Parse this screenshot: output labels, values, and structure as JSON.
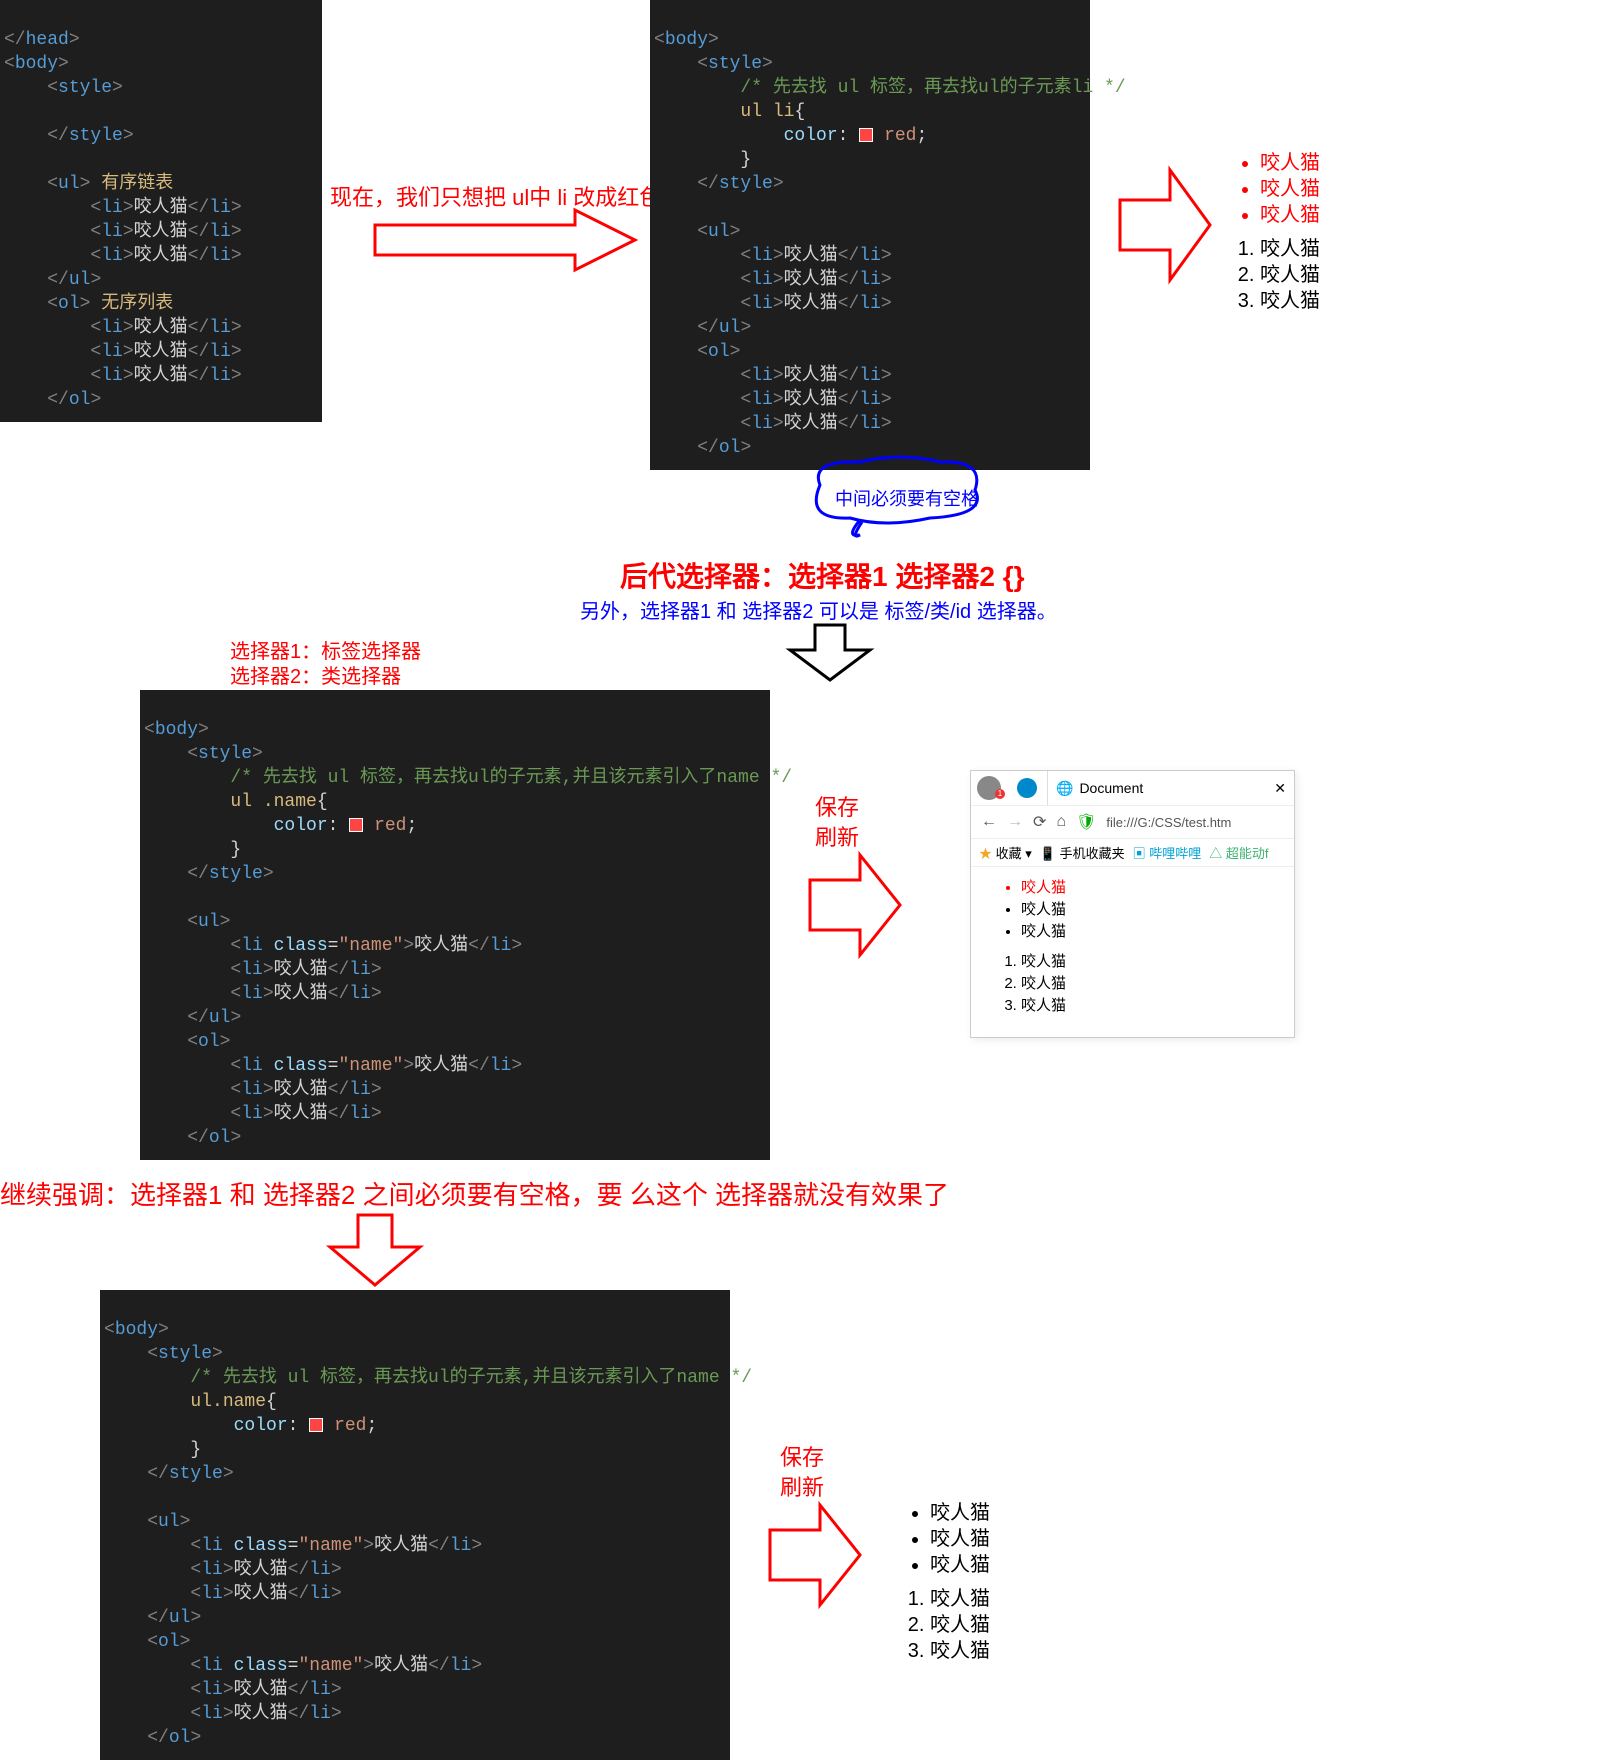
{
  "code1": {
    "open_head_close": "</head>",
    "body": "body",
    "style": "style",
    "ul": "ul",
    "ol": "ol",
    "li": "li",
    "txt": "咬人猫",
    "note_ul": " 有序链表",
    "note_ol": " 无序列表"
  },
  "anno1": "现在，我们只想把 ul中 li 改成红色。",
  "code2": {
    "comment": "/* 先去找 ul 标签，再去找ul的子元素li */",
    "selector": "ul li",
    "prop": "color",
    "val": "red"
  },
  "res1": {
    "items": [
      "咬人猫",
      "咬人猫",
      "咬人猫"
    ]
  },
  "bubble": "中间必须要有空格",
  "title": "后代选择器：选择器1  选择器2 {}",
  "sub": "另外，选择器1 和 选择器2 可以是 标签/类/id 选择器。",
  "sel1": "选择器1：标签选择器",
  "sel2": "选择器2：类选择器",
  "code3": {
    "comment": "/* 先去找 ul 标签，再去找ul的子元素,并且该元素引入了name */",
    "selector": "ul .name",
    "attr": "class",
    "aval": "name"
  },
  "save_refresh": {
    "a": "保存",
    "b": "刷新"
  },
  "browser": {
    "tab_title": "Document",
    "url": "file:///G:/CSS/test.htm",
    "bm_fav": "收藏",
    "bm_mobile": "手机收藏夹",
    "bm_bili": "哔哩哔哩",
    "bm_cn": "超能动f",
    "items": [
      "咬人猫",
      "咬人猫",
      "咬人猫"
    ],
    "olitems": [
      "咬人猫",
      "咬人猫",
      "咬人猫"
    ]
  },
  "emph": "继续强调：选择器1 和 选择器2 之间必须要有空格，要  么这个 选择器就没有效果了",
  "code4": {
    "comment": "/* 先去找 ul 标签，再去找ul的子元素,并且该元素引入了name */",
    "selector": "ul.name"
  },
  "res3": {
    "items": [
      "咬人猫",
      "咬人猫",
      "咬人猫"
    ]
  }
}
